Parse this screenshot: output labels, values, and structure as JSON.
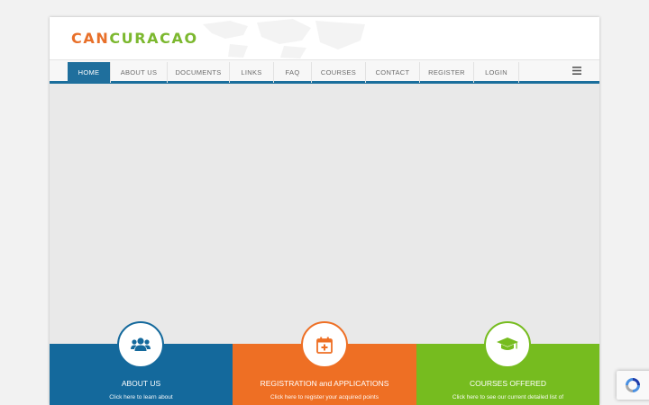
{
  "brand": {
    "part1": "CAN",
    "part2": "CURACAO"
  },
  "nav": {
    "items": [
      {
        "label": "HOME",
        "active": true
      },
      {
        "label": "ABOUT US"
      },
      {
        "label": "DOCUMENTS"
      },
      {
        "label": "LINKS"
      },
      {
        "label": "FAQ"
      },
      {
        "label": "COURSES"
      },
      {
        "label": "CONTACT"
      },
      {
        "label": "REGISTER"
      },
      {
        "label": "LOGIN"
      }
    ],
    "menu_icon": "hamburger-icon"
  },
  "tiles": [
    {
      "title": "ABOUT US",
      "desc": "Click here to learn about",
      "icon": "users-icon",
      "color": "#14699c"
    },
    {
      "title": "REGISTRATION and APPLICATIONS",
      "desc": "Click here to register your acquired points",
      "icon": "calendar-plus-icon",
      "color": "#ee6f24"
    },
    {
      "title": "COURSES OFFERED",
      "desc": "Click here to see our current detailed list of",
      "icon": "graduation-cap-icon",
      "color": "#76bc1f"
    }
  ],
  "colors": {
    "accent_blue": "#1f6f9d",
    "brand_orange": "#e8702a",
    "brand_green": "#7cb82f"
  }
}
